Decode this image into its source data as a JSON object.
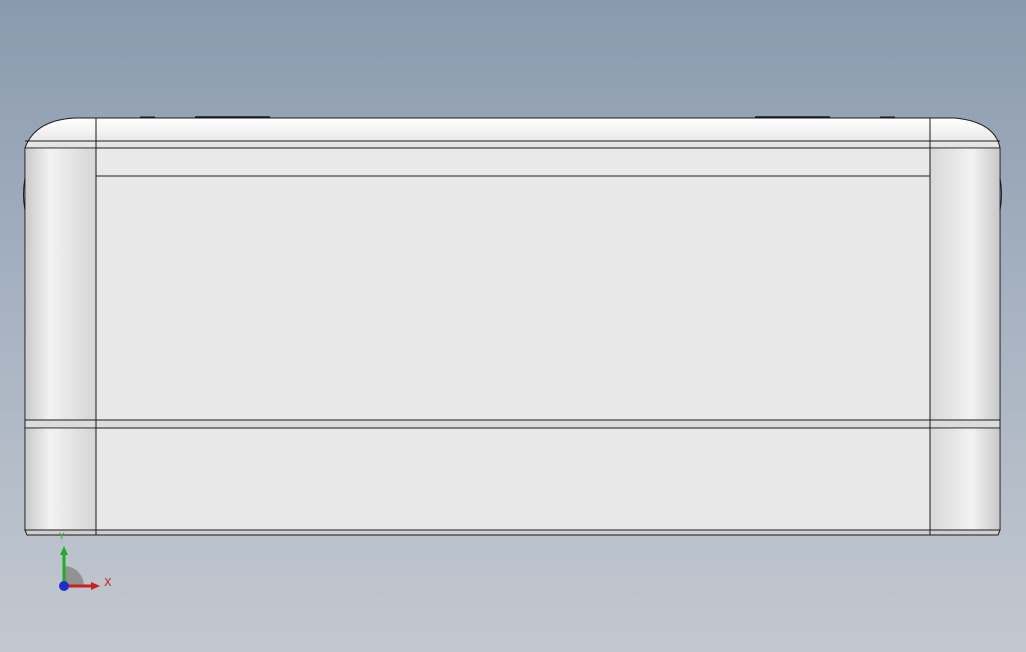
{
  "viewport": {
    "background_top": "#8a9aae",
    "background_bottom": "#c3c8cf"
  },
  "model": {
    "face_color": "#e8e8e8",
    "edge_color": "#1a1a1a"
  },
  "triad": {
    "x_label": "X",
    "y_label": "Y",
    "x_color": "#cc1f1f",
    "y_color": "#1fae1f",
    "z_color": "#1f2fcc"
  }
}
